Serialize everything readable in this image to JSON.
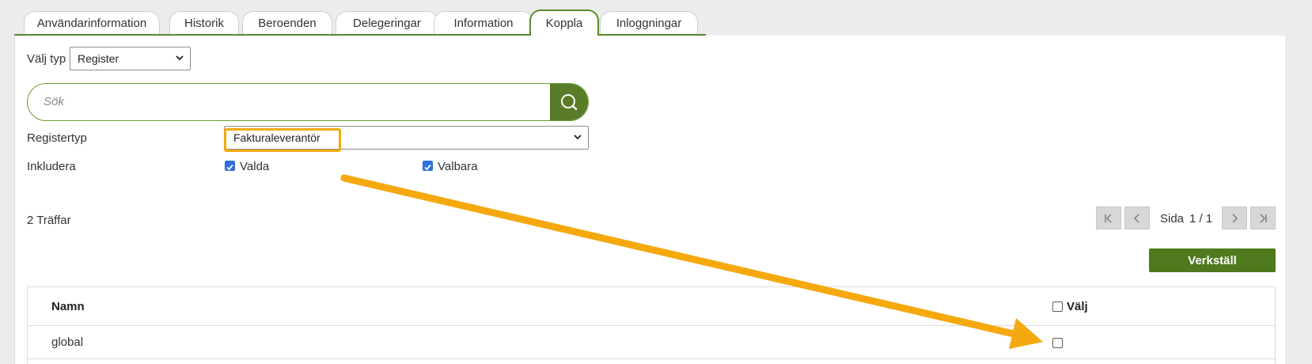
{
  "tabs": [
    {
      "label": "Användarinformation",
      "active": false
    },
    {
      "label": "Historik",
      "active": false
    },
    {
      "label": "Beroenden",
      "active": false
    },
    {
      "label": "Delegeringar",
      "active": false
    },
    {
      "label": "Information",
      "active": false
    },
    {
      "label": "Koppla",
      "active": true
    },
    {
      "label": "Inloggningar",
      "active": false
    }
  ],
  "type_select": {
    "label": "Välj typ",
    "value": "Register"
  },
  "search": {
    "placeholder": "Sök",
    "icon": "search-icon"
  },
  "register_type": {
    "label": "Registertyp",
    "value": "Fakturaleverantör"
  },
  "include": {
    "label": "Inkludera",
    "options": [
      {
        "label": "Valda",
        "checked": true
      },
      {
        "label": "Valbara",
        "checked": true
      }
    ]
  },
  "results": {
    "count_text": "2 Träffar"
  },
  "pagination": {
    "page_label": "Sida",
    "page_value": "1 / 1"
  },
  "apply_label": "Verkställ",
  "table": {
    "columns": {
      "name": "Namn",
      "select": "Välj"
    },
    "rows": [
      {
        "name": "global",
        "selected": false
      }
    ]
  },
  "colors": {
    "brand_green": "#5a7c28",
    "highlight_orange": "#f5a90f",
    "checkbox_blue": "#2f6fe0"
  }
}
